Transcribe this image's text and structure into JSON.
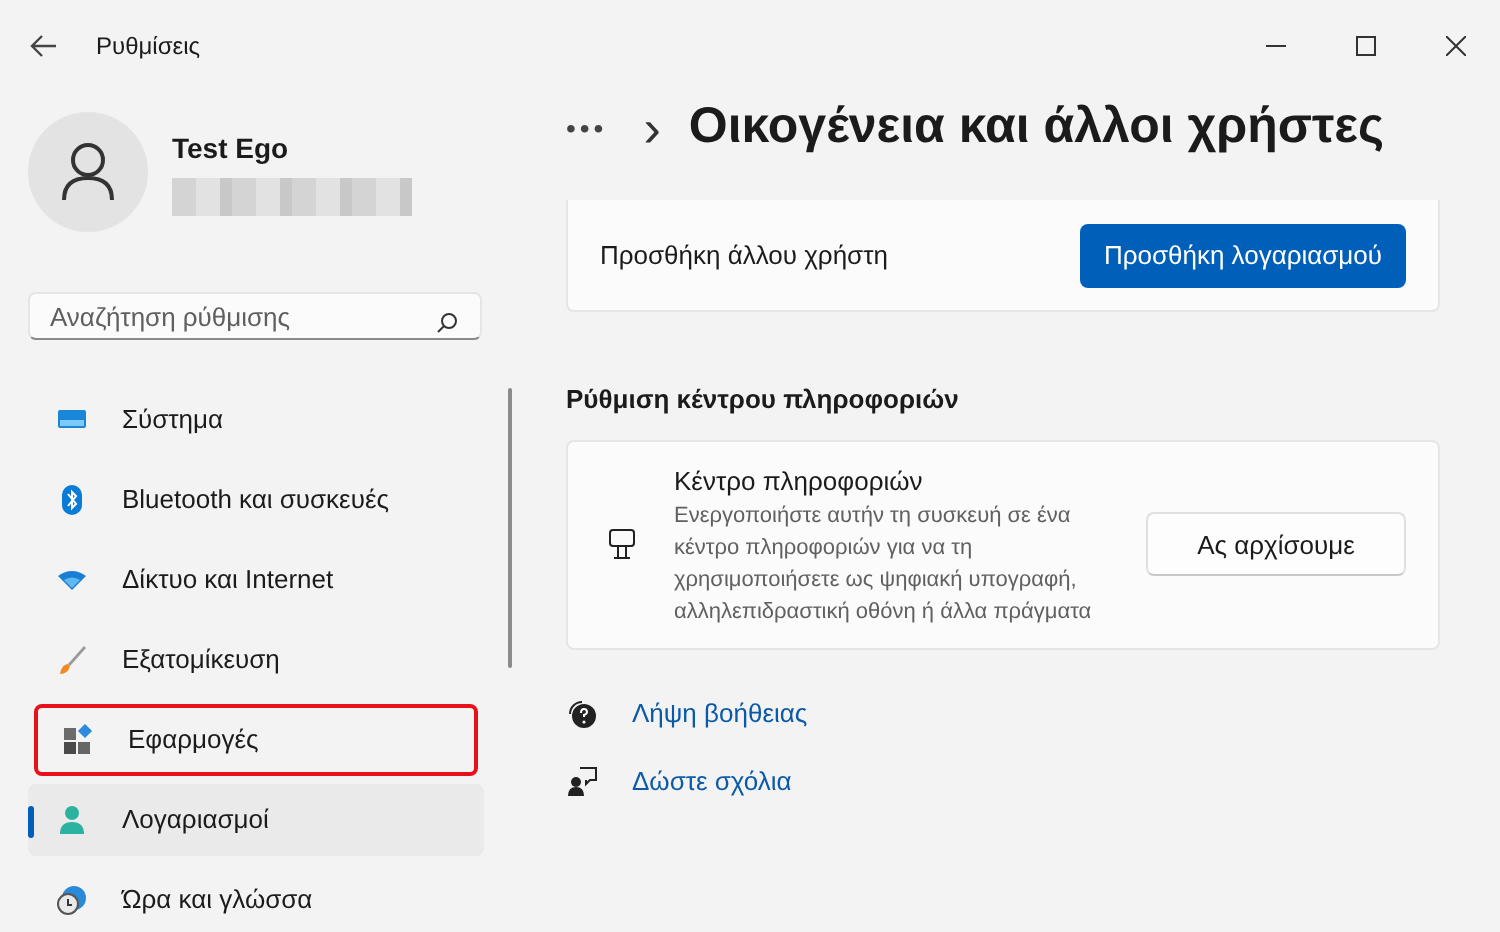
{
  "window": {
    "title": "Ρυθμίσεις"
  },
  "user": {
    "name": "Test Ego",
    "email_redacted": true
  },
  "search": {
    "placeholder": "Αναζήτηση ρύθμισης"
  },
  "sidebar": {
    "items": [
      {
        "label": "Σύστημα",
        "selected": false,
        "highlighted": false
      },
      {
        "label": "Bluetooth και συσκευές",
        "selected": false,
        "highlighted": false
      },
      {
        "label": "Δίκτυο και Internet",
        "selected": false,
        "highlighted": false
      },
      {
        "label": "Εξατομίκευση",
        "selected": false,
        "highlighted": false
      },
      {
        "label": "Εφαρμογές",
        "selected": false,
        "highlighted": true
      },
      {
        "label": "Λογαριασμοί",
        "selected": true,
        "highlighted": false
      },
      {
        "label": "Ώρα και γλώσσα",
        "selected": false,
        "highlighted": false
      }
    ]
  },
  "breadcrumb": {
    "more": "•••",
    "separator": "›",
    "title": "Οικογένεια και άλλοι χρήστες"
  },
  "add_user": {
    "label": "Προσθήκη άλλου χρήστη",
    "button": "Προσθήκη λογαριασμού"
  },
  "kiosk": {
    "heading": "Ρύθμιση κέντρου πληροφοριών",
    "title": "Κέντρο πληροφοριών",
    "description": "Ενεργοποιήστε αυτήν τη συσκευή σε ένα κέντρο πληροφοριών για να τη χρησιμοποιήσετε ως ψηφιακή υπογραφή, αλληλεπιδραστική οθόνη ή άλλα πράγματα",
    "button": "Ας αρχίσουμε"
  },
  "links": [
    {
      "label": "Λήψη βοήθειας"
    },
    {
      "label": "Δώστε σχόλια"
    }
  ]
}
